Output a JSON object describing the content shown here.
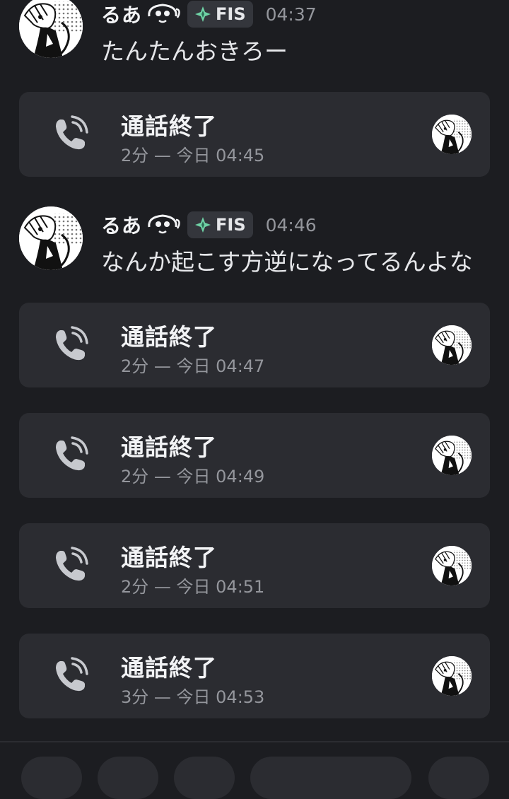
{
  "messages": [
    {
      "username": "るあ",
      "tag": "FIS",
      "time": "04:37",
      "text": "たんたんおきろー"
    },
    {
      "username": "るあ",
      "tag": "FIS",
      "time": "04:46",
      "text": "なんか起こす方逆になってるんよな"
    }
  ],
  "calls": [
    {
      "title": "通話終了",
      "detail": "2分 — 今日 04:45"
    },
    {
      "title": "通話終了",
      "detail": "2分 — 今日 04:47"
    },
    {
      "title": "通話終了",
      "detail": "2分 — 今日 04:49"
    },
    {
      "title": "通話終了",
      "detail": "2分 — 今日 04:51"
    },
    {
      "title": "通話終了",
      "detail": "3分 — 今日 04:53"
    }
  ],
  "colors": {
    "background": "#1c1d21",
    "card": "#2b2c31",
    "tag_bg": "#34363c",
    "muted_text": "#94969c",
    "tag_icon": "#6fd3a6"
  },
  "icons": {
    "call": "phone-call-icon",
    "tag": "guild-tag-icon",
    "mascot": "mascot-emoji-icon",
    "avatar": "user-avatar"
  }
}
